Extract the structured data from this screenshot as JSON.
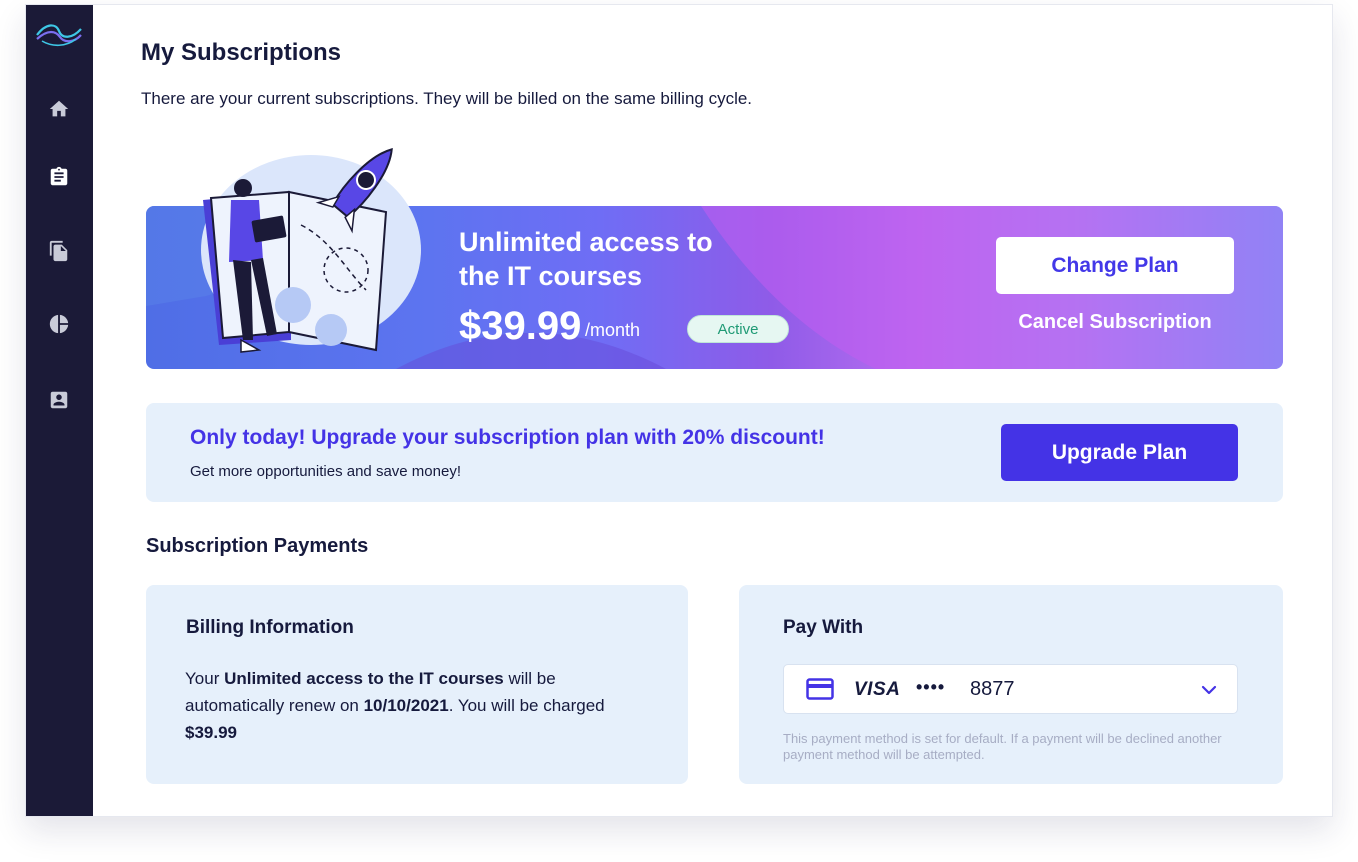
{
  "sidebar": {
    "items": [
      {
        "name": "home",
        "icon": "home-icon"
      },
      {
        "name": "subscriptions",
        "icon": "clipboard-icon"
      },
      {
        "name": "documents",
        "icon": "copy-icon"
      },
      {
        "name": "reports",
        "icon": "pie-chart-icon"
      },
      {
        "name": "profile",
        "icon": "contact-icon"
      }
    ]
  },
  "header": {
    "title": "My Subscriptions",
    "subtitle": "There are your current subscriptions. They will be billed on the same billing cycle."
  },
  "plan": {
    "name": "Unlimited access to the IT courses",
    "price": "$39.99",
    "period": "/month",
    "status": "Active",
    "change_label": "Change Plan",
    "cancel_label": "Cancel Subscription"
  },
  "promo": {
    "title": "Only today! Upgrade your subscription plan with 20% discount!",
    "subtitle": "Get more opportunities and save money!",
    "button_label": "Upgrade Plan"
  },
  "payments": {
    "section_title": "Subscription Payments",
    "billing": {
      "title": "Billing Information",
      "text_1": "Your ",
      "plan_name": "Unlimited access to the IT courses",
      "text_2": " will be automatically renew on ",
      "renew_date": "10/10/2021",
      "text_3": ". You will be charged ",
      "amount": "$39.99"
    },
    "pay_with": {
      "title": "Pay With",
      "card_brand": "VISA",
      "card_mask": "••••",
      "card_last4": "8877",
      "note": "This payment method is set for default. If a payment will be declined another payment method will be attempted."
    }
  },
  "colors": {
    "sidebar_bg": "#1b1a37",
    "accent": "#4433e6",
    "card_bg": "#e6f0fb",
    "active_green": "#1f9a75"
  }
}
